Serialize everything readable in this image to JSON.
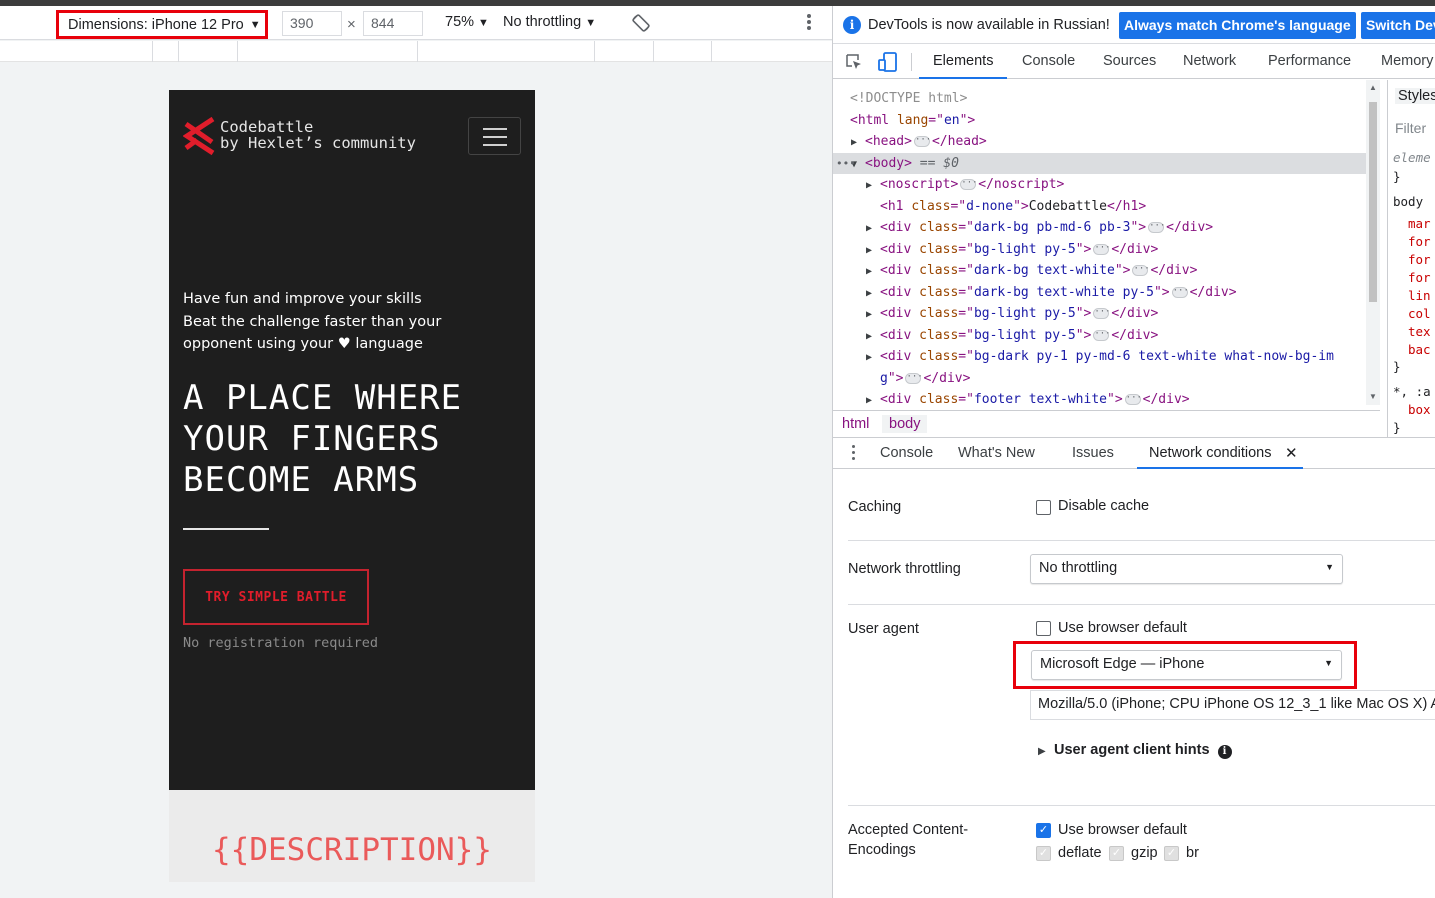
{
  "devbar": {
    "device_label": "Dimensions: iPhone 12 Pro",
    "width": "390",
    "height": "844",
    "zoom": "75%",
    "throttling": "No throttling"
  },
  "site": {
    "brand_line1": "Codebattle",
    "brand_line2": "by Hexlet’s community",
    "intro_line1": "Have fun and improve your skills",
    "intro_line2": "Beat the challenge faster than your",
    "intro_line3a": "opponent using your",
    "intro_line3b": "language",
    "headline": [
      "A PLACE WHERE",
      "YOUR FINGERS",
      "BECOME ARMS"
    ],
    "cta": "TRY SIMPLE BATTLE",
    "note": "No registration required",
    "description": "{{DESCRIPTION}}",
    "accent_color": "#e11d2b"
  },
  "infobar": {
    "text": "DevTools is now available in Russian!",
    "btn_match": "Always match Chrome's language",
    "btn_switch": "Switch Dev"
  },
  "tabs": [
    "Elements",
    "Console",
    "Sources",
    "Network",
    "Performance",
    "Memory"
  ],
  "dom": [
    {
      "indent": 0,
      "tri": "",
      "parts": [
        [
          "cmt",
          "<!DOCTYPE html>"
        ]
      ]
    },
    {
      "indent": 0,
      "tri": "",
      "parts": [
        [
          "tag",
          "<html "
        ],
        [
          "attr",
          "lang"
        ],
        [
          "tag",
          "=\""
        ],
        [
          "val",
          "en"
        ],
        [
          "tag",
          "\">"
        ]
      ]
    },
    {
      "indent": 1,
      "tri": "▶",
      "parts": [
        [
          "tag",
          "<head>"
        ],
        [
          "dots",
          ""
        ],
        [
          "tag",
          "</head>"
        ]
      ]
    },
    {
      "indent": 1,
      "tri": "▼",
      "sel": true,
      "parts": [
        [
          "tag",
          "<body>"
        ],
        [
          "eq",
          " == $0"
        ]
      ]
    },
    {
      "indent": 2,
      "tri": "▶",
      "parts": [
        [
          "tag",
          "<noscript>"
        ],
        [
          "dots",
          ""
        ],
        [
          "tag",
          "</noscript>"
        ]
      ]
    },
    {
      "indent": 2,
      "tri": "",
      "parts": [
        [
          "tag",
          "<h1 "
        ],
        [
          "attr",
          "class"
        ],
        [
          "tag",
          "=\""
        ],
        [
          "val",
          "d-none"
        ],
        [
          "tag",
          "\">"
        ],
        [
          "txt",
          "Codebattle"
        ],
        [
          "tag",
          "</h1>"
        ]
      ]
    },
    {
      "indent": 2,
      "tri": "▶",
      "parts": [
        [
          "tag",
          "<div "
        ],
        [
          "attr",
          "class"
        ],
        [
          "tag",
          "=\""
        ],
        [
          "val",
          "dark-bg pb-md-6 pb-3"
        ],
        [
          "tag",
          "\">"
        ],
        [
          "dots",
          ""
        ],
        [
          "tag",
          "</div>"
        ]
      ]
    },
    {
      "indent": 2,
      "tri": "▶",
      "parts": [
        [
          "tag",
          "<div "
        ],
        [
          "attr",
          "class"
        ],
        [
          "tag",
          "=\""
        ],
        [
          "val",
          "bg-light py-5"
        ],
        [
          "tag",
          "\">"
        ],
        [
          "dots",
          ""
        ],
        [
          "tag",
          "</div>"
        ]
      ]
    },
    {
      "indent": 2,
      "tri": "▶",
      "parts": [
        [
          "tag",
          "<div "
        ],
        [
          "attr",
          "class"
        ],
        [
          "tag",
          "=\""
        ],
        [
          "val",
          "dark-bg text-white"
        ],
        [
          "tag",
          "\">"
        ],
        [
          "dots",
          ""
        ],
        [
          "tag",
          "</div>"
        ]
      ]
    },
    {
      "indent": 2,
      "tri": "▶",
      "parts": [
        [
          "tag",
          "<div "
        ],
        [
          "attr",
          "class"
        ],
        [
          "tag",
          "=\""
        ],
        [
          "val",
          "dark-bg text-white py-5"
        ],
        [
          "tag",
          "\">"
        ],
        [
          "dots",
          ""
        ],
        [
          "tag",
          "</div>"
        ]
      ]
    },
    {
      "indent": 2,
      "tri": "▶",
      "parts": [
        [
          "tag",
          "<div "
        ],
        [
          "attr",
          "class"
        ],
        [
          "tag",
          "=\""
        ],
        [
          "val",
          "bg-light py-5"
        ],
        [
          "tag",
          "\">"
        ],
        [
          "dots",
          ""
        ],
        [
          "tag",
          "</div>"
        ]
      ]
    },
    {
      "indent": 2,
      "tri": "▶",
      "parts": [
        [
          "tag",
          "<div "
        ],
        [
          "attr",
          "class"
        ],
        [
          "tag",
          "=\""
        ],
        [
          "val",
          "bg-light py-5"
        ],
        [
          "tag",
          "\">"
        ],
        [
          "dots",
          ""
        ],
        [
          "tag",
          "</div>"
        ]
      ]
    },
    {
      "indent": 2,
      "tri": "▶",
      "parts": [
        [
          "tag",
          "<div "
        ],
        [
          "attr",
          "class"
        ],
        [
          "tag",
          "=\""
        ],
        [
          "val",
          "bg-dark py-1 py-md-6 text-white what-now-bg-im"
        ]
      ]
    },
    {
      "indent": 2,
      "tri": "",
      "parts": [
        [
          "val",
          "g"
        ],
        [
          "tag",
          "\">"
        ],
        [
          "dots",
          ""
        ],
        [
          "tag",
          "</div>"
        ]
      ]
    },
    {
      "indent": 2,
      "tri": "▶",
      "parts": [
        [
          "tag",
          "<div "
        ],
        [
          "attr",
          "class"
        ],
        [
          "tag",
          "=\""
        ],
        [
          "val",
          "footer text-white"
        ],
        [
          "tag",
          "\">"
        ],
        [
          "dots",
          ""
        ],
        [
          "tag",
          "</div>"
        ]
      ]
    }
  ],
  "styles_pane": {
    "tab": "Styles",
    "filter": "Filter",
    "lines": [
      "eleme",
      "}",
      "body",
      "mar",
      "for",
      "for",
      "for",
      "lin",
      "col",
      "tex",
      "bac",
      "}",
      "*, :a",
      "box",
      "}"
    ]
  },
  "crumbs": [
    "html",
    "body"
  ],
  "drawer_tabs": [
    "Console",
    "What's New",
    "Issues",
    "Network conditions"
  ],
  "network_conditions": {
    "caching_label": "Caching",
    "disable_cache": "Disable cache",
    "throttling_label": "Network throttling",
    "throttling_value": "No throttling",
    "ua_label": "User agent",
    "use_default": "Use browser default",
    "ua_value": "Microsoft Edge — iPhone",
    "ua_string": "Mozilla/5.0 (iPhone; CPU iPhone OS 12_3_1 like Mac OS X) A",
    "hints": "User agent client hints",
    "encodings_label_1": "Accepted Content-",
    "encodings_label_2": "Encodings",
    "enc_default": "Use browser default",
    "enc_deflate": "deflate",
    "enc_gzip": "gzip",
    "enc_br": "br"
  }
}
